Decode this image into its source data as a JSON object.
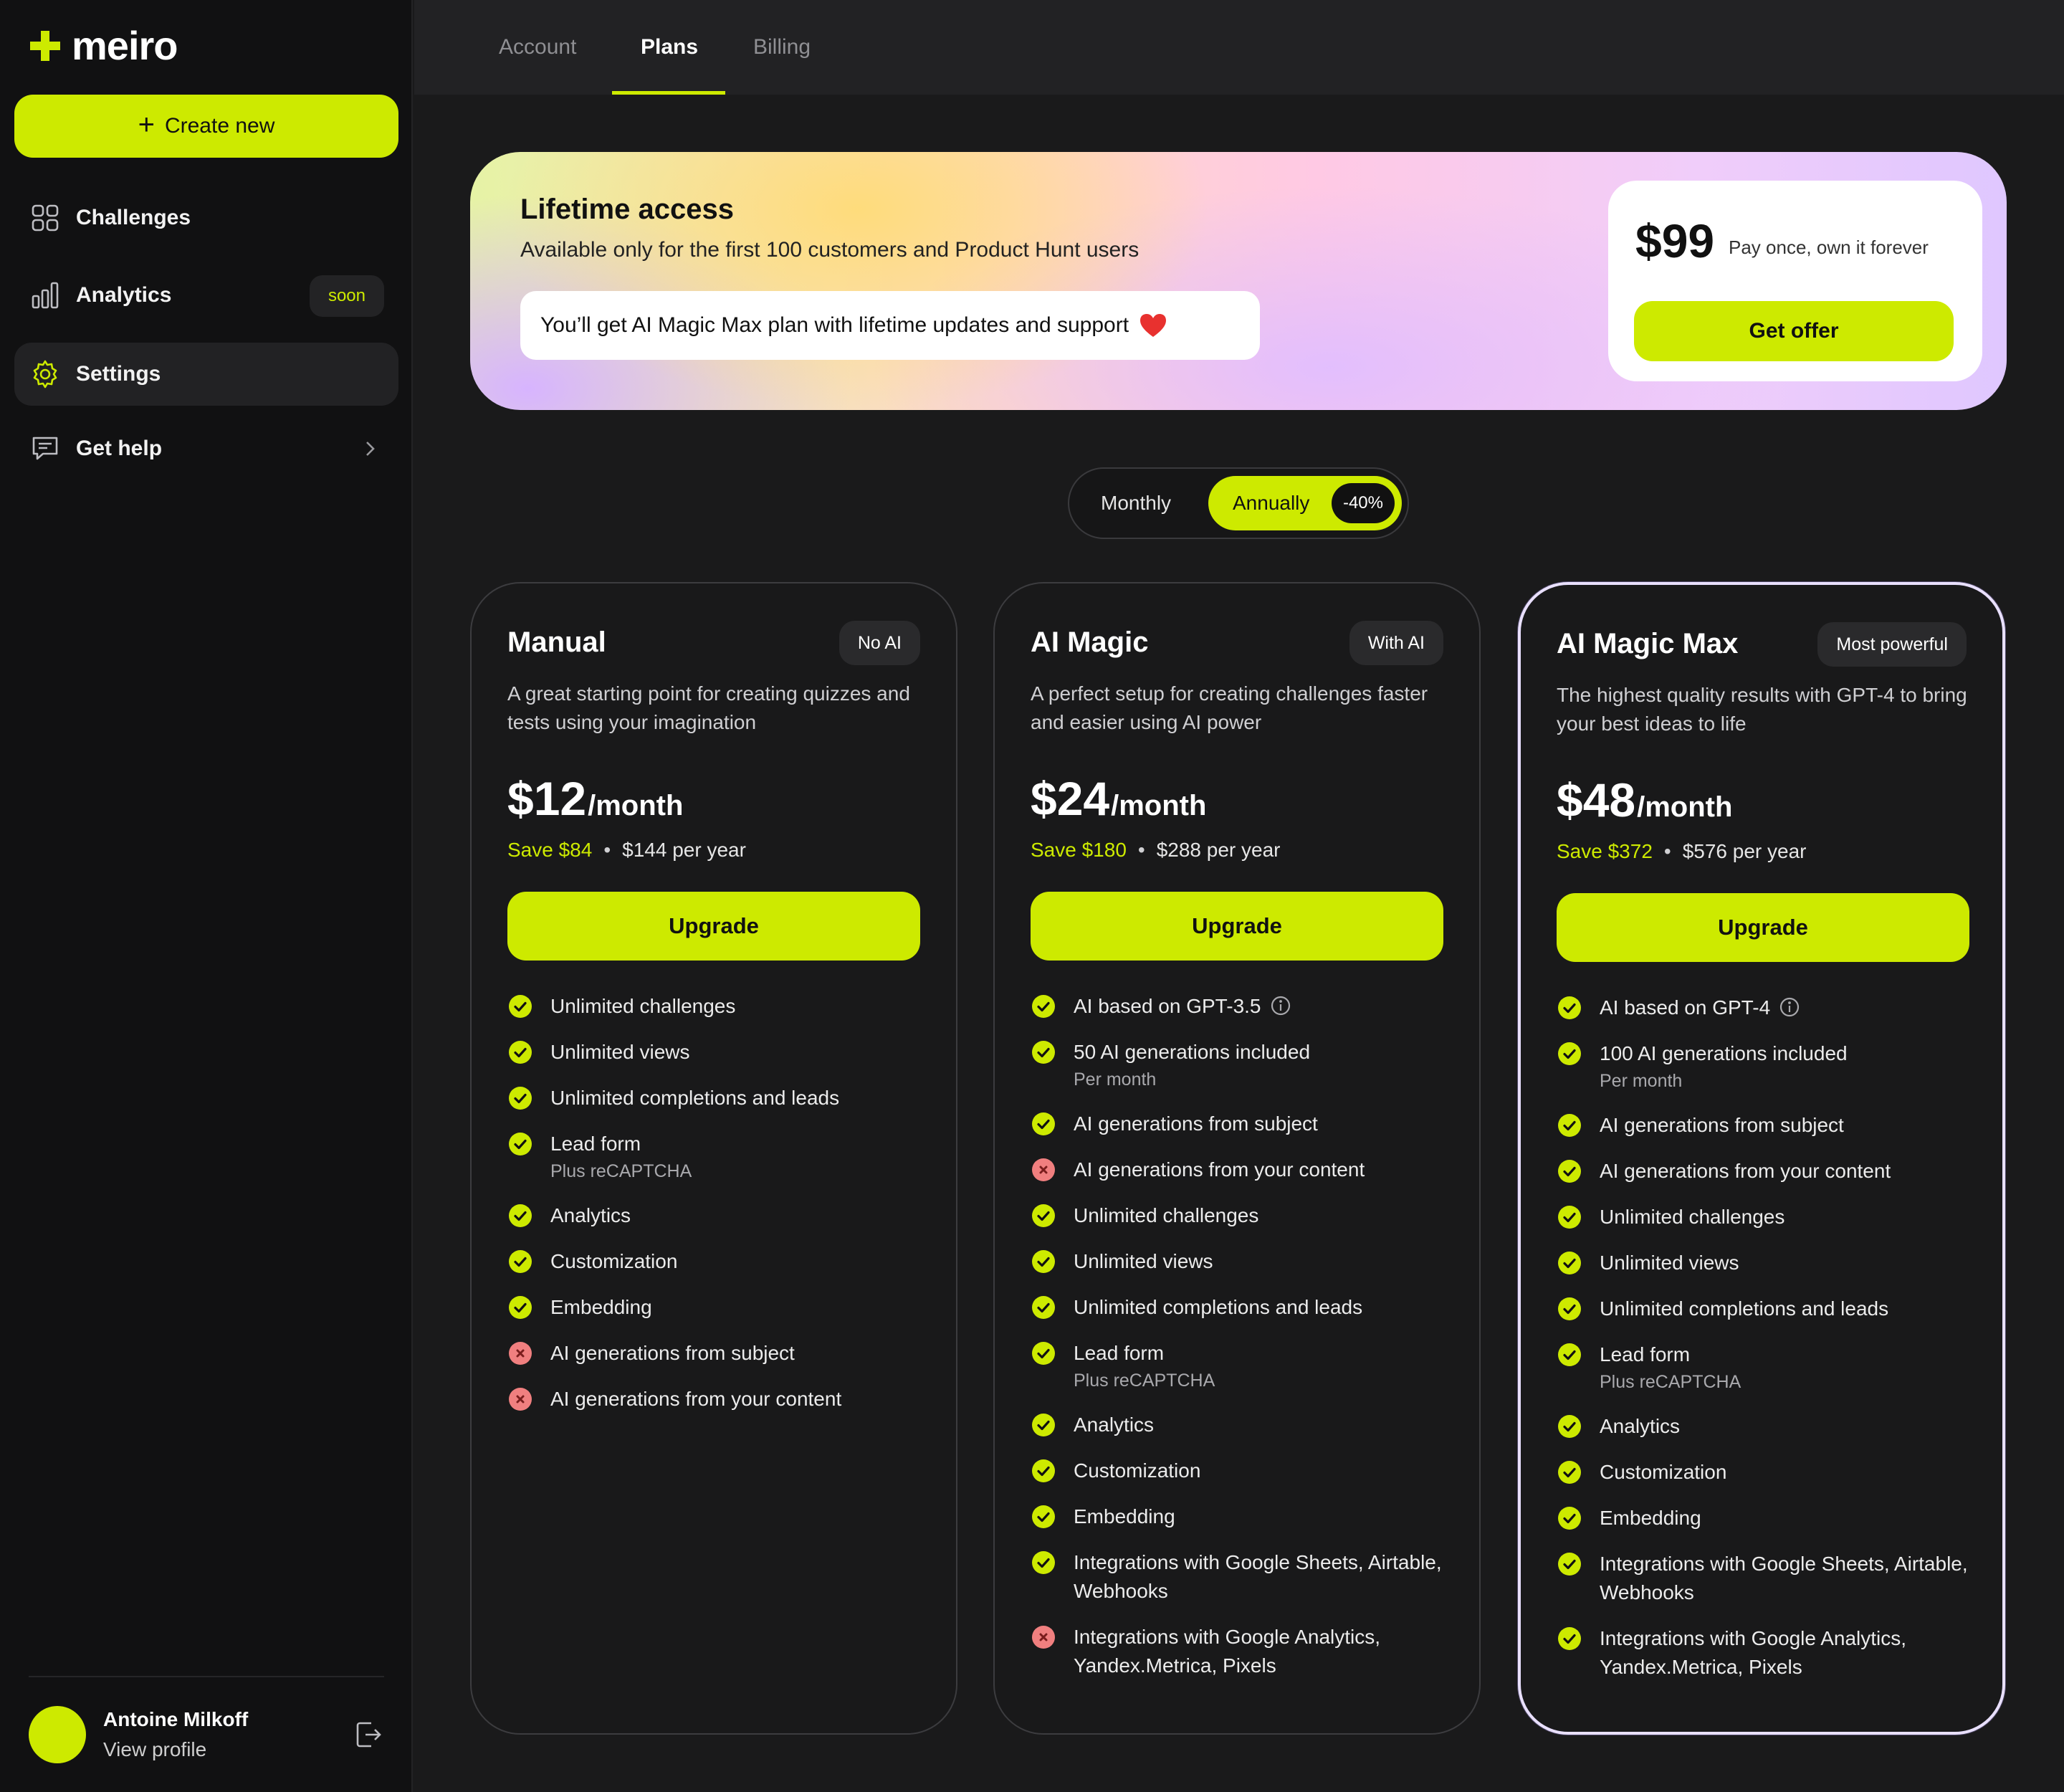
{
  "brand": {
    "name": "meiro",
    "accent": "#cdea00"
  },
  "sidebar": {
    "create_label": "Create new",
    "items": [
      {
        "label": "Challenges",
        "icon": "grid-icon"
      },
      {
        "label": "Analytics",
        "icon": "bar-chart-icon",
        "badge": "soon"
      },
      {
        "label": "Settings",
        "icon": "gear-icon",
        "active": true
      },
      {
        "label": "Get help",
        "icon": "chat-icon"
      }
    ],
    "profile": {
      "name": "Antoine Milkoff",
      "link": "View profile"
    }
  },
  "tabs": [
    {
      "label": "Account"
    },
    {
      "label": "Plans",
      "active": true
    },
    {
      "label": "Billing"
    }
  ],
  "banner": {
    "title": "Lifetime access",
    "subtitle": "Available only for the first 100 customers and Product Hunt users",
    "pill": "You’ll get AI Magic Max plan with lifetime updates and support",
    "price": "$99",
    "price_note": "Pay once, own it forever",
    "cta": "Get offer"
  },
  "billing_toggle": {
    "monthly": "Monthly",
    "annually": "Annually",
    "discount": "-40%",
    "selected": "annually"
  },
  "plans": [
    {
      "name": "Manual",
      "badge": "No AI",
      "description": "A great starting point for creating quizzes and tests using your imagination",
      "price": "$12",
      "per": "/month",
      "save": "Save $84",
      "yearly": "$144 per year",
      "cta": "Upgrade",
      "features": [
        {
          "text": "Unlimited challenges",
          "included": true
        },
        {
          "text": "Unlimited views",
          "included": true
        },
        {
          "text": "Unlimited completions and leads",
          "included": true
        },
        {
          "text": "Lead form",
          "sub": "Plus reCAPTCHA",
          "included": true
        },
        {
          "text": "Analytics",
          "included": true
        },
        {
          "text": "Customization",
          "included": true
        },
        {
          "text": "Embedding",
          "included": true
        },
        {
          "text": "AI generations from subject",
          "included": false
        },
        {
          "text": "AI generations from your content",
          "included": false
        }
      ]
    },
    {
      "name": "AI Magic",
      "badge": "With AI",
      "description": "A perfect setup for creating challenges faster and easier using AI power",
      "price": "$24",
      "per": "/month",
      "save": "Save $180",
      "yearly": "$288 per year",
      "cta": "Upgrade",
      "features": [
        {
          "text": "AI based on GPT-3.5",
          "included": true,
          "info": true
        },
        {
          "text": "50 AI generations included",
          "sub": "Per month",
          "included": true
        },
        {
          "text": "AI generations from subject",
          "included": true
        },
        {
          "text": "AI generations from your content",
          "included": false
        },
        {
          "text": "Unlimited challenges",
          "included": true
        },
        {
          "text": "Unlimited views",
          "included": true
        },
        {
          "text": "Unlimited completions and leads",
          "included": true
        },
        {
          "text": "Lead form",
          "sub": "Plus reCAPTCHA",
          "included": true
        },
        {
          "text": "Analytics",
          "included": true
        },
        {
          "text": "Customization",
          "included": true
        },
        {
          "text": "Embedding",
          "included": true
        },
        {
          "text": "Integrations with Google Sheets, Airtable, Webhooks",
          "included": true
        },
        {
          "text": "Integrations with Google Analytics, Yandex.Metrica, Pixels",
          "included": false
        }
      ]
    },
    {
      "name": "AI Magic Max",
      "badge": "Most powerful",
      "description": "The highest quality results with GPT-4 to bring your best ideas to life",
      "price": "$48",
      "per": "/month",
      "save": "Save $372",
      "yearly": "$576 per year",
      "cta": "Upgrade",
      "features": [
        {
          "text": "AI based on GPT-4",
          "included": true,
          "info": true
        },
        {
          "text": "100 AI generations included",
          "sub": "Per month",
          "included": true
        },
        {
          "text": "AI generations from subject",
          "included": true
        },
        {
          "text": "AI generations from your content",
          "included": true
        },
        {
          "text": "Unlimited challenges",
          "included": true
        },
        {
          "text": "Unlimited views",
          "included": true
        },
        {
          "text": "Unlimited completions and leads",
          "included": true
        },
        {
          "text": "Lead form",
          "sub": "Plus reCAPTCHA",
          "included": true
        },
        {
          "text": "Analytics",
          "included": true
        },
        {
          "text": "Customization",
          "included": true
        },
        {
          "text": "Embedding",
          "included": true
        },
        {
          "text": "Integrations with Google Sheets, Airtable, Webhooks",
          "included": true
        },
        {
          "text": "Integrations with Google Analytics, Yandex.Metrica, Pixels",
          "included": true
        }
      ]
    }
  ]
}
